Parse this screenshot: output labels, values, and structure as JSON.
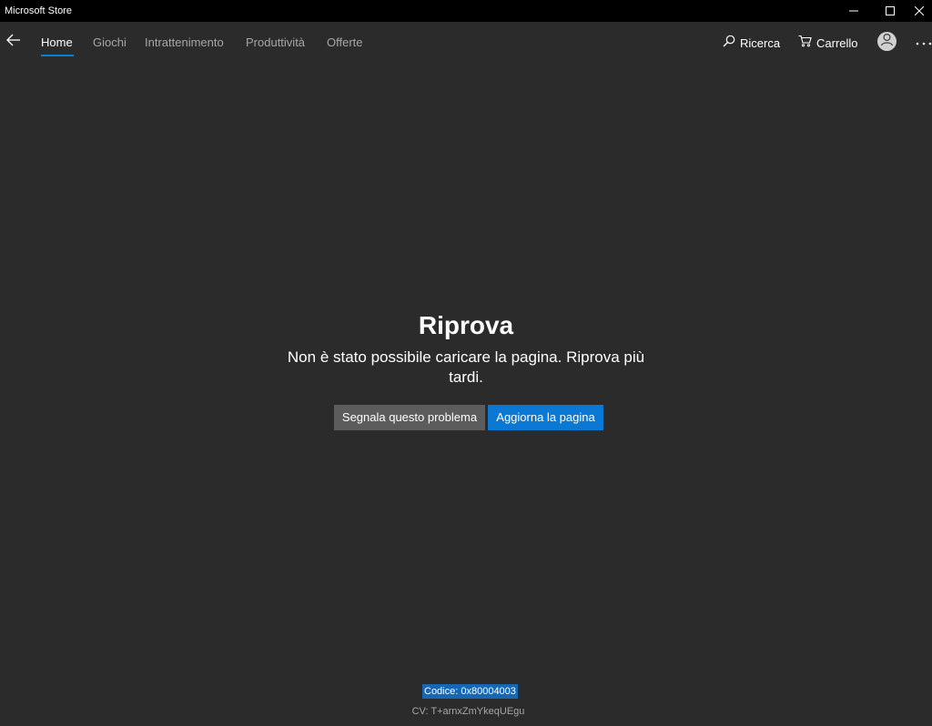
{
  "window": {
    "title": "Microsoft Store",
    "controls": {
      "minimize": "minimize-icon",
      "maximize": "maximize-icon",
      "close": "close-icon"
    }
  },
  "nav": {
    "back_icon": "back-arrow-icon",
    "tabs": [
      {
        "label": "Home",
        "active": true
      },
      {
        "label": "Giochi",
        "active": false
      },
      {
        "label": "Intrattenimento",
        "active": false
      },
      {
        "label": "Produttività",
        "active": false
      },
      {
        "label": "Offerte",
        "active": false
      }
    ],
    "search": {
      "label": "Ricerca",
      "icon": "search-icon"
    },
    "cart": {
      "label": "Carrello",
      "icon": "cart-icon"
    },
    "account_icon": "user-icon",
    "more_icon": "more-icon"
  },
  "error": {
    "title": "Riprova",
    "message": "Non è stato possibile caricare la pagina. Riprova più tardi.",
    "report_button": "Segnala questo problema",
    "refresh_button": "Aggiorna la pagina",
    "code": "Codice: 0x80004003",
    "cv": "CV: T+arnxZmYkeqUEgu"
  },
  "colors": {
    "background": "#2b2b2b",
    "titlebar": "#000000",
    "accent": "#0b78d4",
    "secondary_button": "#5c5c5c",
    "selection": "#1668b5"
  }
}
